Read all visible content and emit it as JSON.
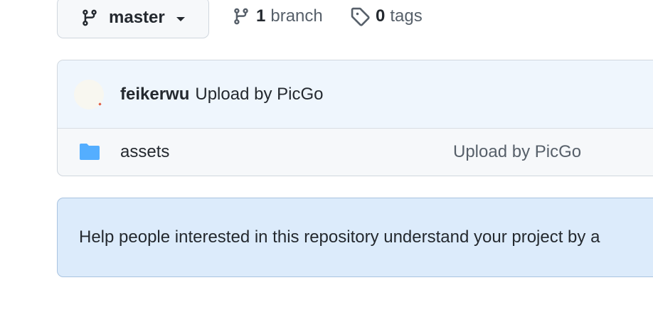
{
  "toolbar": {
    "branch_selector": {
      "name": "master",
      "icon": "git-branch-icon"
    },
    "branches": {
      "count": "1",
      "label": "branch",
      "icon": "git-branch-icon"
    },
    "tags": {
      "count": "0",
      "label": "tags",
      "icon": "tag-icon"
    }
  },
  "latest_commit": {
    "author": "feikerwu",
    "message": "Upload by PicGo"
  },
  "files": [
    {
      "name": "assets",
      "type": "folder",
      "icon": "folder-icon",
      "last_commit": "Upload by PicGo"
    }
  ],
  "readme_banner": {
    "text": "Help people interested in this repository understand your project by a"
  },
  "colors": {
    "folder": "#54aeff",
    "border": "#d0d7de",
    "banner_bg": "#dcebfb",
    "muted_text": "#57606a"
  }
}
